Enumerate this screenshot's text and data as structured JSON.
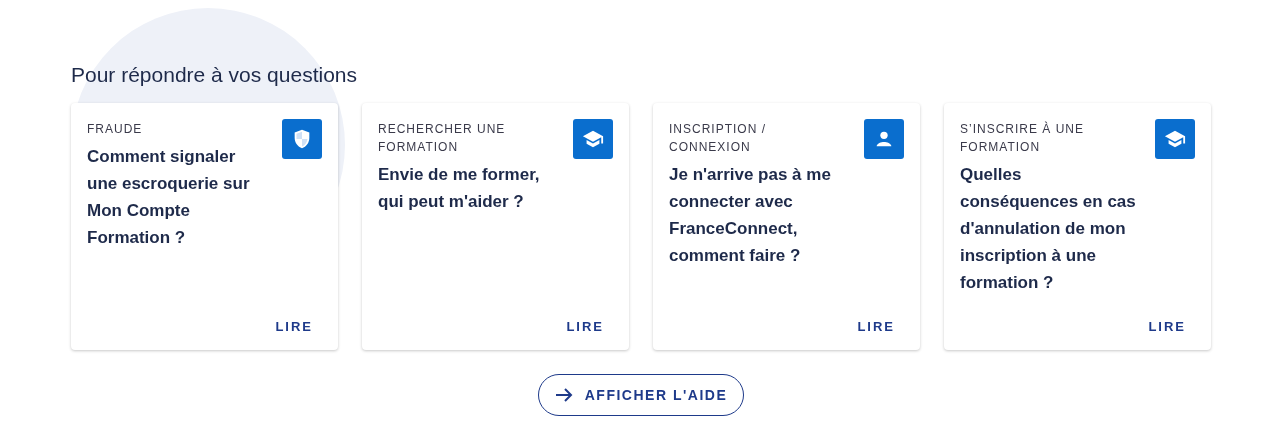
{
  "heading": "Pour répondre à vos questions",
  "cards": [
    {
      "category": "FRAUDE",
      "kind": "shield",
      "question": "Comment signaler une escroquerie sur Mon Compte Formation ?",
      "link": "LIRE"
    },
    {
      "category": "RECHERCHER UNE FORMATION",
      "kind": "cap",
      "question": "Envie de me former, qui peut m'aider ?",
      "link": "LIRE"
    },
    {
      "category": "INSCRIPTION / CONNEXION",
      "kind": "person",
      "question": "Je n'arrive pas à me connecter avec FranceConnect, comment faire ?",
      "link": "LIRE"
    },
    {
      "category": "S’INSCRIRE À UNE FORMATION",
      "kind": "cap",
      "question": "Quelles conséquences en cas d'annulation de mon inscription à une formation ?",
      "link": "LIRE"
    }
  ],
  "button": "AFFICHER L'AIDE"
}
